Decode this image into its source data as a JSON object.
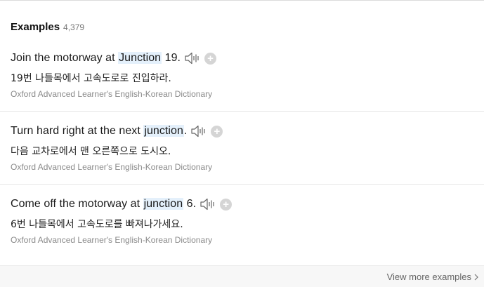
{
  "header": {
    "title": "Examples",
    "count": "4,379"
  },
  "examples": [
    {
      "before": "Join the motorway at ",
      "highlight": "Junction",
      "after": " 19.",
      "translation": "19번 나들목에서 고속도로로 진입하라.",
      "source": "Oxford Advanced Learner's English-Korean Dictionary",
      "speaker_icon": "speaker-icon",
      "add_icon": "plus-icon"
    },
    {
      "before": "Turn hard right at the next ",
      "highlight": "junction",
      "after": ".",
      "translation": "다음 교차로에서 맨 오른쪽으로 도시오.",
      "source": "Oxford Advanced Learner's English-Korean Dictionary",
      "speaker_icon": "speaker-icon",
      "add_icon": "plus-icon"
    },
    {
      "before": "Come off the motorway at ",
      "highlight": "junction",
      "after": " 6.",
      "translation": "6번 나들목에서 고속도로를 빠져나가세요.",
      "source": "Oxford Advanced Learner's English-Korean Dictionary",
      "speaker_icon": "speaker-icon",
      "add_icon": "plus-icon"
    }
  ],
  "footer": {
    "view_more": "View more examples"
  },
  "colors": {
    "highlight_bg": "#e4f0fb",
    "text": "#1b1b1b",
    "muted": "#8a8a8a"
  }
}
